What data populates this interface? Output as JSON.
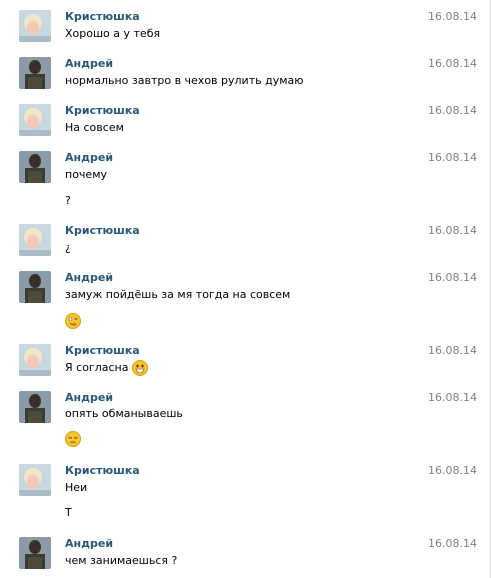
{
  "messages": [
    {
      "author": "Кристюшка",
      "date": "16.08.14",
      "lines": [
        "Хорошо а у тебя"
      ]
    },
    {
      "author": "Андрей",
      "date": "16.08.14",
      "lines": [
        "нормально завтро в чехов рулить думаю"
      ]
    },
    {
      "author": "Кристюшка",
      "date": "16.08.14",
      "lines": [
        "На совсем"
      ]
    },
    {
      "author": "Андрей",
      "date": "16.08.14",
      "lines": [
        "почему",
        "?"
      ]
    },
    {
      "author": "Кристюшка",
      "date": "16.08.14",
      "lines": [
        "¿"
      ]
    },
    {
      "author": "Андрей",
      "date": "16.08.14",
      "lines": [
        "замуж пойдёшь за мя тогда на совсем"
      ],
      "emoji": "winking-tongue-emoji"
    },
    {
      "author": "Кристюшка",
      "date": "16.08.14",
      "lines": [
        "Я согласна"
      ],
      "inline_emoji": "grinning-emoji"
    },
    {
      "author": "Андрей",
      "date": "16.08.14",
      "lines": [
        "опять обманываешь"
      ],
      "emoji": "pensive-emoji"
    },
    {
      "author": "Кристюшка",
      "date": "16.08.14",
      "lines": [
        "Неи",
        "Т"
      ]
    },
    {
      "author": "Андрей",
      "date": "16.08.14",
      "lines": [
        "чем занимаешься ?"
      ]
    }
  ],
  "colors": {
    "name": "#2b587a",
    "date": "#808080",
    "text": "#000000"
  }
}
